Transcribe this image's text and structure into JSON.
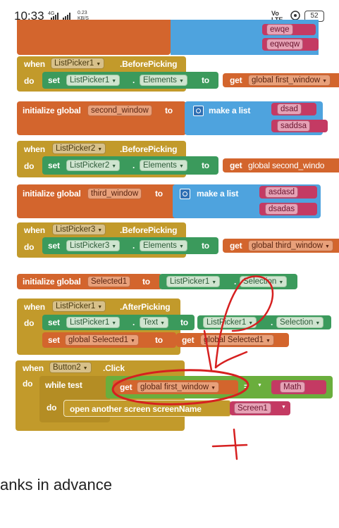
{
  "status_bar": {
    "time": "10:33",
    "network": "4G",
    "speed": "0.23",
    "speed_unit": "KB/S",
    "volte": "Vo LTE",
    "battery": "52"
  },
  "top_block": {
    "items": [
      "ewqe",
      "eqweqw"
    ]
  },
  "event1": {
    "when": "when",
    "component": "ListPicker1",
    "event": ".BeforePicking",
    "do": "do",
    "set": "set",
    "target": "ListPicker1",
    "dot": ".",
    "property": "Elements",
    "to": "to",
    "get": "get",
    "variable": "global first_window"
  },
  "init2": {
    "label": "initialize global",
    "name": "second_window",
    "to": "to",
    "make_list": "make a list",
    "items": [
      "dsad",
      "saddsa"
    ]
  },
  "event2": {
    "when": "when",
    "component": "ListPicker2",
    "event": ".BeforePicking",
    "do": "do",
    "set": "set",
    "target": "ListPicker2",
    "dot": ".",
    "property": "Elements",
    "to": "to",
    "get": "get",
    "variable": "global second_windo"
  },
  "init3": {
    "label": "initialize global",
    "name": "third_window",
    "to": "to",
    "make_list": "make a list",
    "items": [
      "asdasd",
      "dsadas"
    ]
  },
  "event3": {
    "when": "when",
    "component": "ListPicker3",
    "event": ".BeforePicking",
    "do": "do",
    "set": "set",
    "target": "ListPicker3",
    "dot": ".",
    "property": "Elements",
    "to": "to",
    "get": "get",
    "variable": "global third_window"
  },
  "init_selected": {
    "label": "initialize global",
    "name": "Selected1",
    "to": "to",
    "component": "ListPicker1",
    "dot": ".",
    "property": "Selection"
  },
  "event4": {
    "when": "when",
    "component": "ListPicker1",
    "event": ".AfterPicking",
    "do": "do",
    "set": "set",
    "target": "ListPicker1",
    "dot": ".",
    "property": "Text",
    "to": "to",
    "source_component": "ListPicker1",
    "source_property": "Selection",
    "set2": "set",
    "variable2": "global Selected1",
    "to2": "to",
    "get": "get",
    "get_variable": "global Selected1"
  },
  "event5": {
    "when": "when",
    "component": "Button2",
    "event": ".Click",
    "do": "do",
    "while": "while test",
    "get": "get",
    "variable": "global first_window",
    "op": "=",
    "math": "Math",
    "do2": "do",
    "open_screen": "open another screen screenName",
    "screen": "Screen1"
  },
  "footer": {
    "text": "anks in advance"
  },
  "colors": {
    "event_gold": "#c29a2b",
    "variable_orange": "#d3652d",
    "list_blue": "#4ea3de",
    "component_green": "#3b9a5c",
    "text_magenta": "#c43a63",
    "annotation_red": "#d62020"
  }
}
